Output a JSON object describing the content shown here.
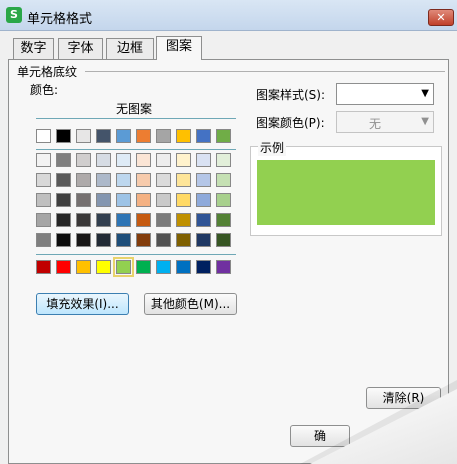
{
  "window": {
    "title": "单元格格式",
    "app_icon_glyph": "S",
    "close_glyph": "✕"
  },
  "tabs": [
    {
      "label": "数字",
      "active": false
    },
    {
      "label": "字体",
      "active": false
    },
    {
      "label": "边框",
      "active": false
    },
    {
      "label": "图案",
      "active": true
    }
  ],
  "shading": {
    "group_label": "单元格底纹",
    "color_label": "颜色:",
    "no_pattern_label": "无图案",
    "selected_color": "#92d050",
    "theme_top_row": [
      "#ffffff",
      "#000000",
      "#e7e6e6",
      "#44546a",
      "#5b9bd5",
      "#ed7d31",
      "#a5a5a5",
      "#ffc000",
      "#4472c4",
      "#70ad47"
    ],
    "theme_rows": [
      [
        "#f2f2f2",
        "#7f7f7f",
        "#d0cece",
        "#d6dce4",
        "#deebf6",
        "#fbe5d5",
        "#ededed",
        "#fff2cc",
        "#d9e2f3",
        "#e2efd9"
      ],
      [
        "#d8d8d8",
        "#595959",
        "#aeaaaa",
        "#adb9ca",
        "#bdd7ee",
        "#f7cbac",
        "#dbdbdb",
        "#fee599",
        "#b4c6e7",
        "#c5e0b3"
      ],
      [
        "#bfbfbf",
        "#3f3f3f",
        "#757070",
        "#8496b0",
        "#9dc3e6",
        "#f4b183",
        "#c9c9c9",
        "#ffd965",
        "#8eaadb",
        "#a8d08d"
      ],
      [
        "#a5a5a5",
        "#262626",
        "#3a3838",
        "#323f4f",
        "#2e75b5",
        "#c55a11",
        "#7b7b7b",
        "#bf9000",
        "#2f5496",
        "#538135"
      ],
      [
        "#7f7f7f",
        "#0c0c0c",
        "#171616",
        "#222a35",
        "#1e4e79",
        "#833c0b",
        "#525252",
        "#7f6000",
        "#1f3864",
        "#375623"
      ]
    ],
    "standard_row": [
      "#c00000",
      "#ff0000",
      "#ffc000",
      "#ffff00",
      "#92d050",
      "#00b050",
      "#00b0f0",
      "#0070c0",
      "#002060",
      "#7030a0"
    ],
    "fill_effects_button": "填充效果(I)...",
    "more_colors_button": "其他颜色(M)..."
  },
  "pattern": {
    "style_label": "图案样式(S):",
    "style_value": "",
    "color_label": "图案颜色(P):",
    "color_value": "无"
  },
  "sample": {
    "label": "示例"
  },
  "buttons": {
    "clear": "清除(R)",
    "ok_partial": "确"
  }
}
